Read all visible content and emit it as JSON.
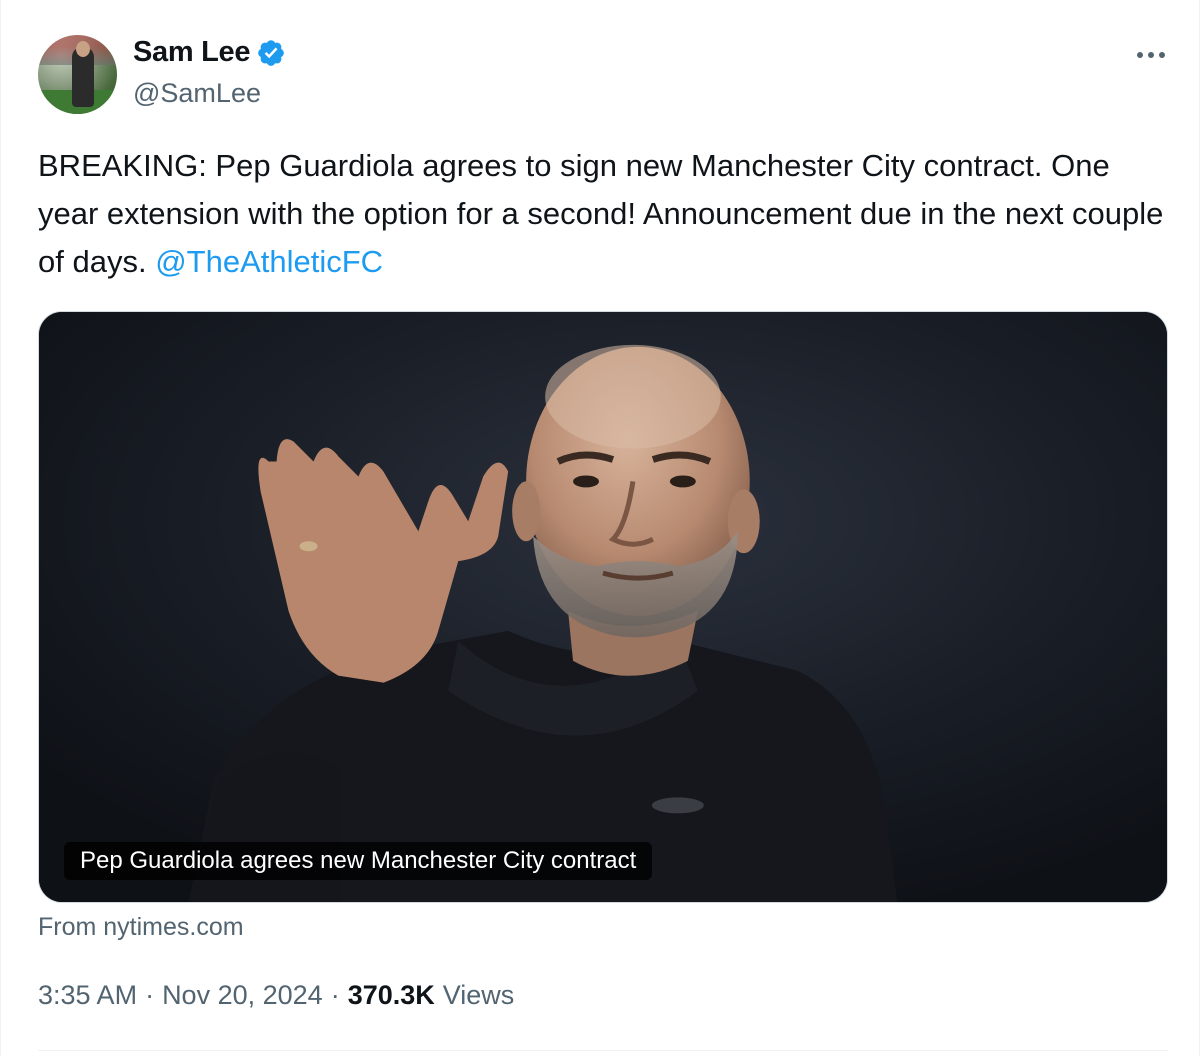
{
  "author": {
    "display_name": "Sam Lee",
    "handle": "@SamLee",
    "verified": true
  },
  "tweet": {
    "text_before_mention": "BREAKING: Pep Guardiola agrees to sign new Manchester City contract. One year extension with the option for a second! Announcement due in the next couple of days. ",
    "mention": "@TheAthleticFC"
  },
  "link_card": {
    "caption": "Pep Guardiola agrees new Manchester City contract",
    "source": "From nytimes.com"
  },
  "meta": {
    "time": "3:35 AM",
    "separator": "·",
    "date": "Nov 20, 2024",
    "views_count": "370.3K",
    "views_label": "Views"
  },
  "colors": {
    "accent": "#1d9bf0",
    "text": "#0f1419",
    "muted": "#536471"
  },
  "icons": {
    "verified": "verified-badge-icon",
    "more": "more-options-icon"
  }
}
